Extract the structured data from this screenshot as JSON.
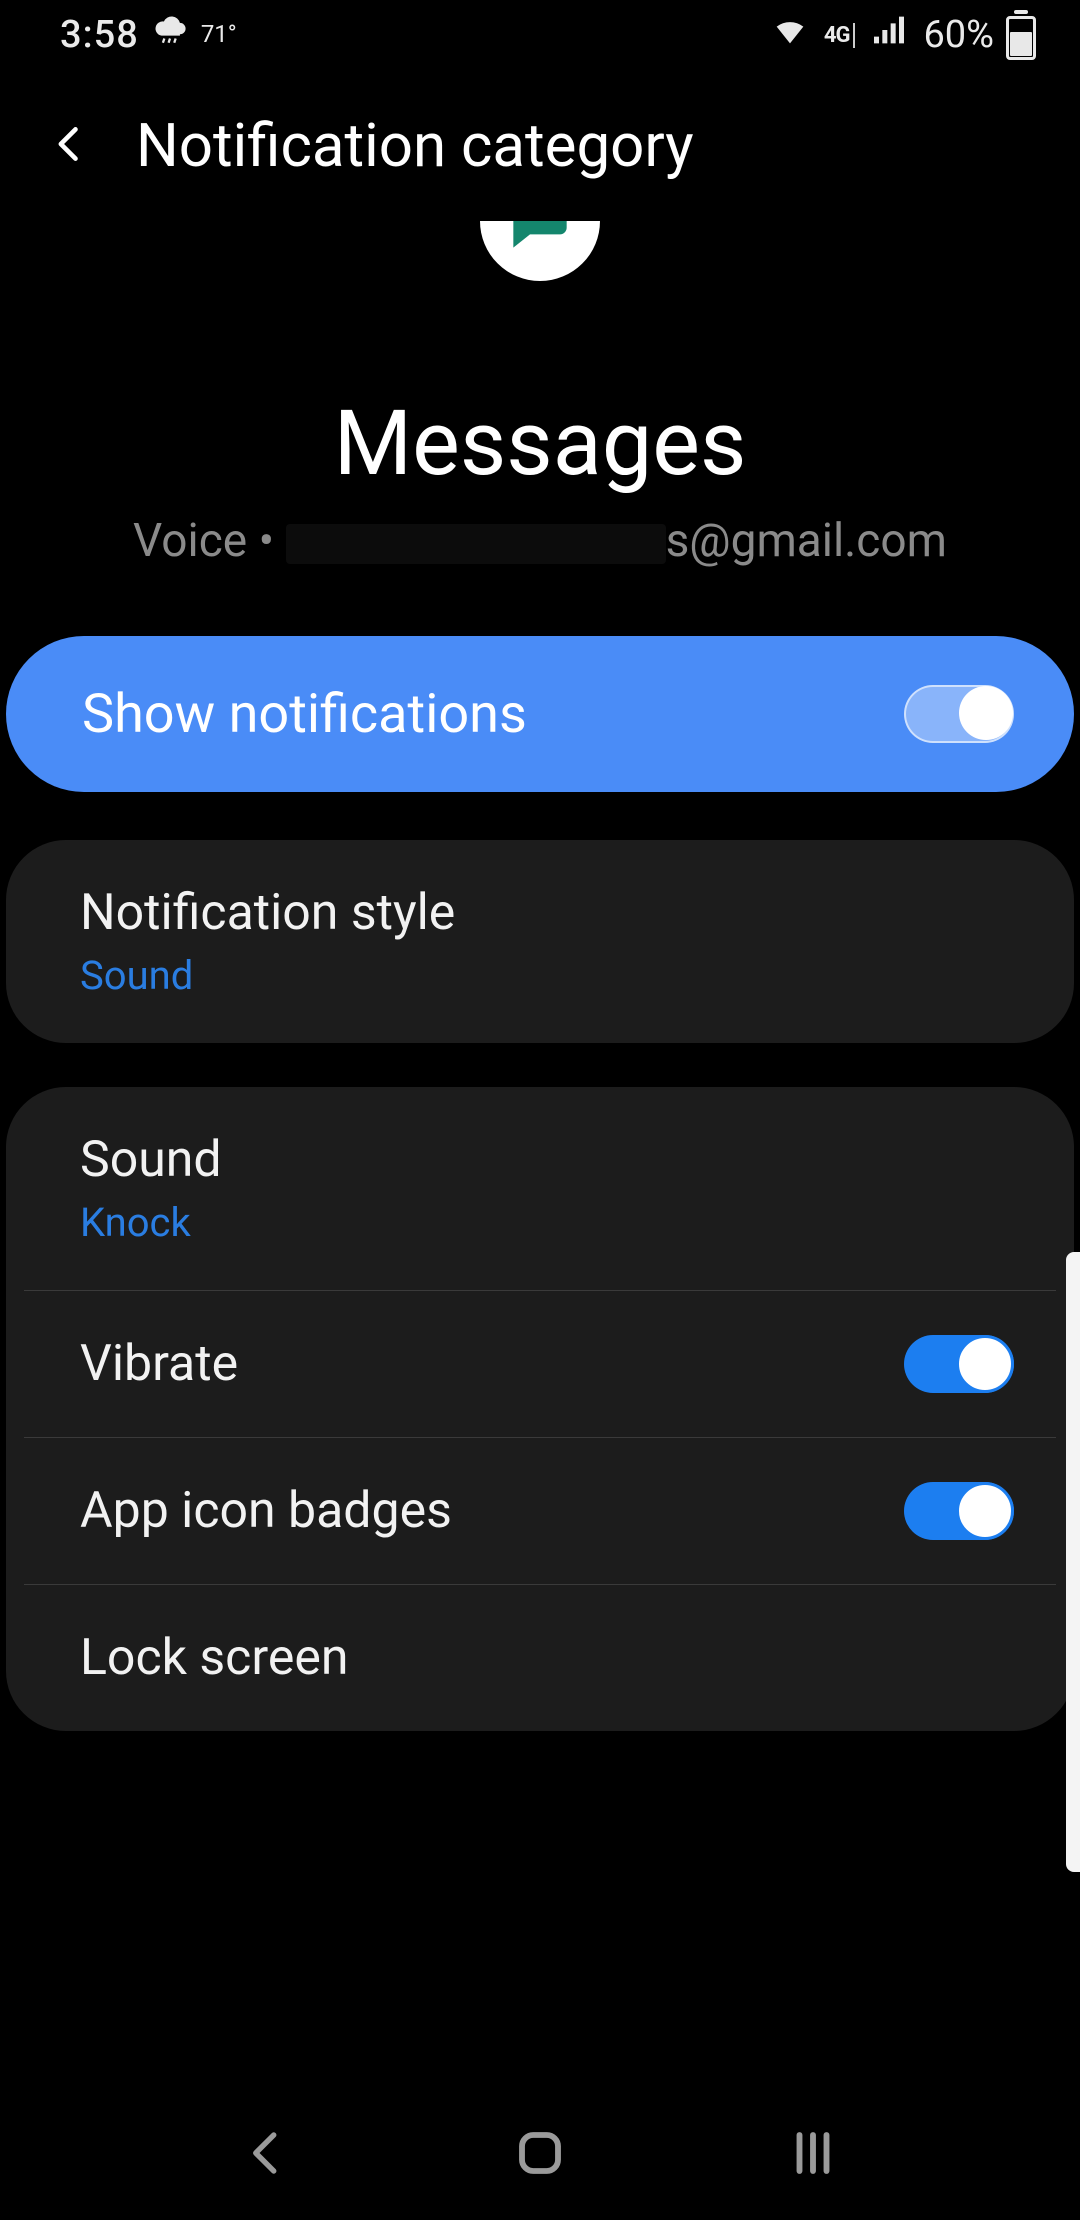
{
  "status": {
    "time": "3:58",
    "temp": "71°",
    "network_label": "4G",
    "battery_text": "60%"
  },
  "header": {
    "title": "Notification category"
  },
  "hero": {
    "app_name": "Messages",
    "subtitle_prefix": "Voice",
    "subtitle_bullet": "•",
    "subtitle_suffix": "s@gmail.com"
  },
  "show_notifications": {
    "label": "Show notifications",
    "enabled": true
  },
  "style_card": {
    "title": "Notification style",
    "value": "Sound"
  },
  "settings": [
    {
      "title": "Sound",
      "value": "Knock",
      "has_toggle": false
    },
    {
      "title": "Vibrate",
      "has_toggle": true,
      "enabled": true
    },
    {
      "title": "App icon badges",
      "has_toggle": true,
      "enabled": true
    },
    {
      "title": "Lock screen",
      "has_toggle": false
    }
  ],
  "colors": {
    "accent": "#4a8cf7",
    "link": "#2a7de1",
    "card": "#1c1c1c"
  }
}
